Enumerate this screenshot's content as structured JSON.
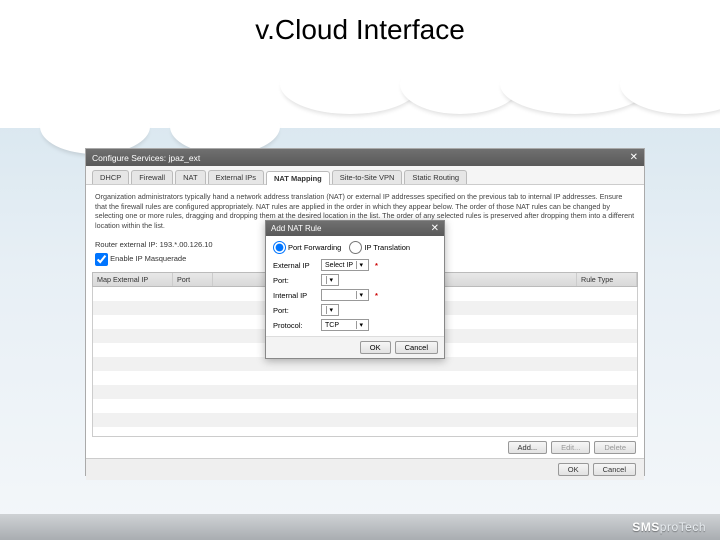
{
  "page_title": "v.Cloud Interface",
  "brand": {
    "bold": "SMS",
    "light": "proTech"
  },
  "window": {
    "title": "Configure Services: jpaz_ext",
    "tabs": [
      "DHCP",
      "Firewall",
      "NAT",
      "External IPs",
      "NAT Mapping",
      "Site-to-Site VPN",
      "Static Routing"
    ],
    "active_tab_index": 4,
    "description": "Organization administrators typically hand a network address translation (NAT) or external IP addresses specified on the previous tab to internal IP addresses. Ensure that the firewall rules are configured appropriately. NAT rules are applied in the order in which they appear below. The order of those NAT rules can be changed by selecting one or more rules, dragging and dropping them at the desired location in the list. The order of any selected rules is preserved after dropping them into a different location within the list.",
    "router_ip_label": "Router external IP:",
    "router_ip_value": "193.*.00.126.10",
    "masq_label": "Enable IP Masquerade",
    "masq_checked": true,
    "columns": [
      "Map External IP",
      "Port",
      "",
      "",
      "Rule Type"
    ],
    "grid_buttons": [
      "Add...",
      "Edit...",
      "Delete"
    ],
    "footer_buttons": [
      "OK",
      "Cancel"
    ]
  },
  "modal": {
    "title": "Add NAT Rule",
    "radio_port": "Port Forwarding",
    "radio_ip": "IP Translation",
    "radio_selected": "port",
    "fields": {
      "external_ip_label": "External IP",
      "external_ip_value": "Select IP",
      "port1_label": "Port:",
      "port1_value": "",
      "internal_ip_label": "Internal IP",
      "internal_ip_value": "",
      "port2_label": "Port:",
      "port2_value": "",
      "protocol_label": "Protocol:",
      "protocol_value": "TCP"
    },
    "buttons": [
      "OK",
      "Cancel"
    ]
  }
}
